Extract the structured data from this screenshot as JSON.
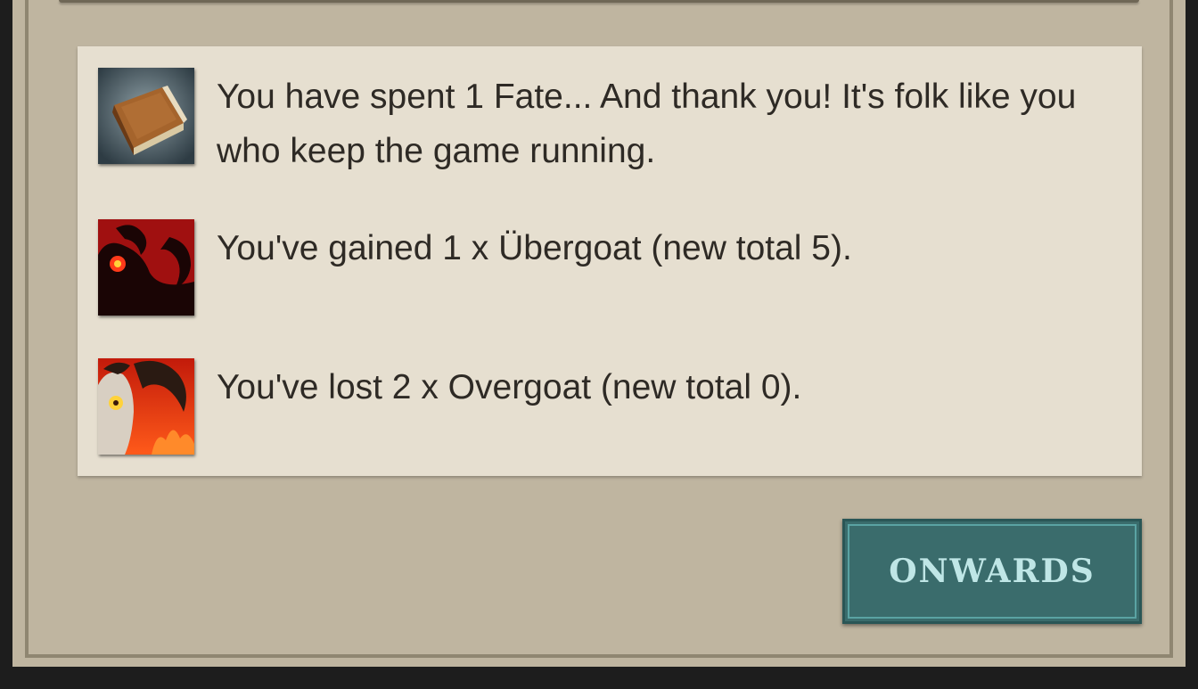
{
  "messages": [
    {
      "icon": "book-icon",
      "text": "You have spent 1 Fate... And thank you! It's folk like you who keep the game running."
    },
    {
      "icon": "ubergoat-icon",
      "text": "You've gained 1 x Übergoat (new total 5)."
    },
    {
      "icon": "overgoat-icon",
      "text": "You've lost 2 x Overgoat (new total 0)."
    }
  ],
  "actions": {
    "onwards_label": "ONWARDS"
  },
  "colors": {
    "page_background": "#1d1d1d",
    "panel": "#bfb5a0",
    "card": "#e6dfd0",
    "button": "#3a6c6c",
    "button_text": "#bfe6e6"
  }
}
